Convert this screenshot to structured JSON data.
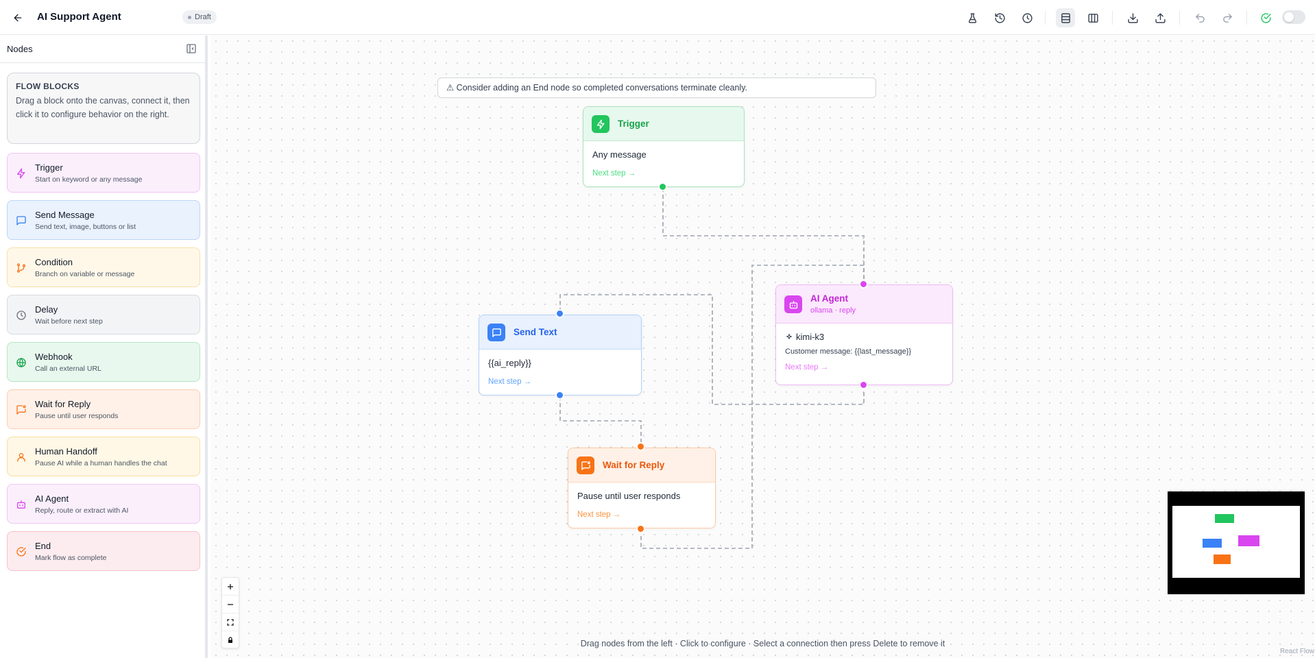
{
  "header": {
    "title": "AI Support Agent",
    "status_badge": "Draft"
  },
  "sidebar": {
    "title": "Nodes",
    "info": {
      "title": "FLOW BLOCKS",
      "text": "Drag a block onto the canvas, connect it, then click it to configure behavior on the right."
    },
    "blocks": [
      {
        "name": "Trigger",
        "desc": "Start on keyword or any message"
      },
      {
        "name": "Send Message",
        "desc": "Send text, image, buttons or list"
      },
      {
        "name": "Condition",
        "desc": "Branch on variable or message"
      },
      {
        "name": "Delay",
        "desc": "Wait before next step"
      },
      {
        "name": "Webhook",
        "desc": "Call an external URL"
      },
      {
        "name": "Wait for Reply",
        "desc": "Pause until user responds"
      },
      {
        "name": "Human Handoff",
        "desc": "Pause AI while a human handles the chat"
      },
      {
        "name": "AI Agent",
        "desc": "Reply, route or extract with AI"
      },
      {
        "name": "End",
        "desc": "Mark flow as complete"
      }
    ]
  },
  "canvas": {
    "warning": "⚠ Consider adding an End node so completed conversations terminate cleanly.",
    "hint": "Drag nodes from the left · Click to configure · Select a connection then press Delete to remove it",
    "attribution": "React Flow"
  },
  "nodes": {
    "trigger": {
      "title": "Trigger",
      "main": "Any message",
      "next": "Next step →"
    },
    "send_text": {
      "title": "Send Text",
      "main": "{{ai_reply}}",
      "next": "Next step →"
    },
    "wait_reply": {
      "title": "Wait for Reply",
      "main": "Pause until user responds",
      "next": "Next step →"
    },
    "ai_agent": {
      "title": "AI Agent",
      "subtitle": "ollama · reply",
      "model": "kimi-k3",
      "prompt": "Customer message: {{last_message}}",
      "next": "Next step →"
    }
  },
  "colors": {
    "trigger": "#22c55e",
    "send": "#3b82f6",
    "condition": "#f97316",
    "delay": "#9ca3af",
    "webhook": "#16a34a",
    "wait": "#f97316",
    "handoff": "#f59e0b",
    "ai": "#d946ef",
    "end": "#f43f5e"
  },
  "icons": {
    "back": "arrow-left-icon",
    "toolbar": [
      "flask-icon",
      "history-icon",
      "clock-icon",
      "rows-layout-icon",
      "columns-layout-icon",
      "download-icon",
      "upload-icon",
      "undo-icon",
      "redo-icon",
      "check-circle-icon"
    ]
  }
}
